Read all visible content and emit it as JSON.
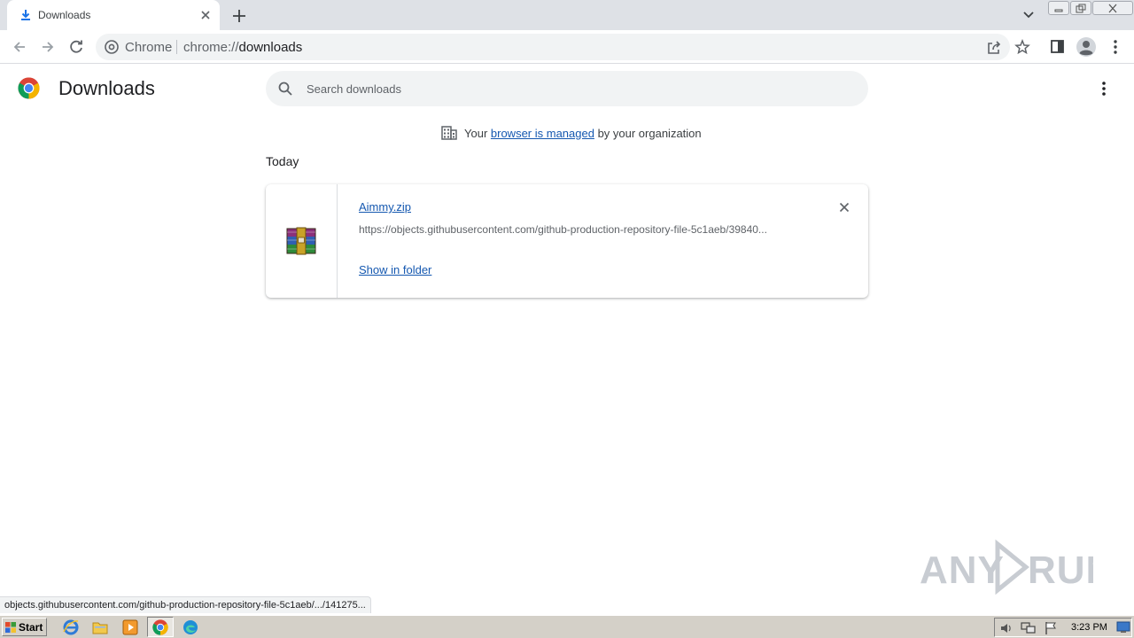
{
  "tab": {
    "title": "Downloads"
  },
  "toolbar": {
    "site_label": "Chrome",
    "url_scheme": "chrome://",
    "url_path": "downloads"
  },
  "page": {
    "title": "Downloads",
    "search_placeholder": "Search downloads",
    "managed_prefix": "Your ",
    "managed_link": "browser is managed",
    "managed_suffix": " by your organization",
    "section_date": "Today"
  },
  "downloads": [
    {
      "file_name": "Aimmy.zip",
      "url": "https://objects.githubusercontent.com/github-production-repository-file-5c1aeb/39840...",
      "action": "Show in folder",
      "icon": "winrar-archive-icon"
    }
  ],
  "status_bar": {
    "text": "objects.githubusercontent.com/github-production-repository-file-5c1aeb/.../141275..."
  },
  "watermark": {
    "text_left": "ANY",
    "text_right": "RUN"
  },
  "taskbar": {
    "start_label": "Start",
    "clock": "3:23 PM"
  },
  "colors": {
    "link": "#1558b0",
    "accent": "#1a73e8",
    "tabstrip": "#dee1e6"
  }
}
